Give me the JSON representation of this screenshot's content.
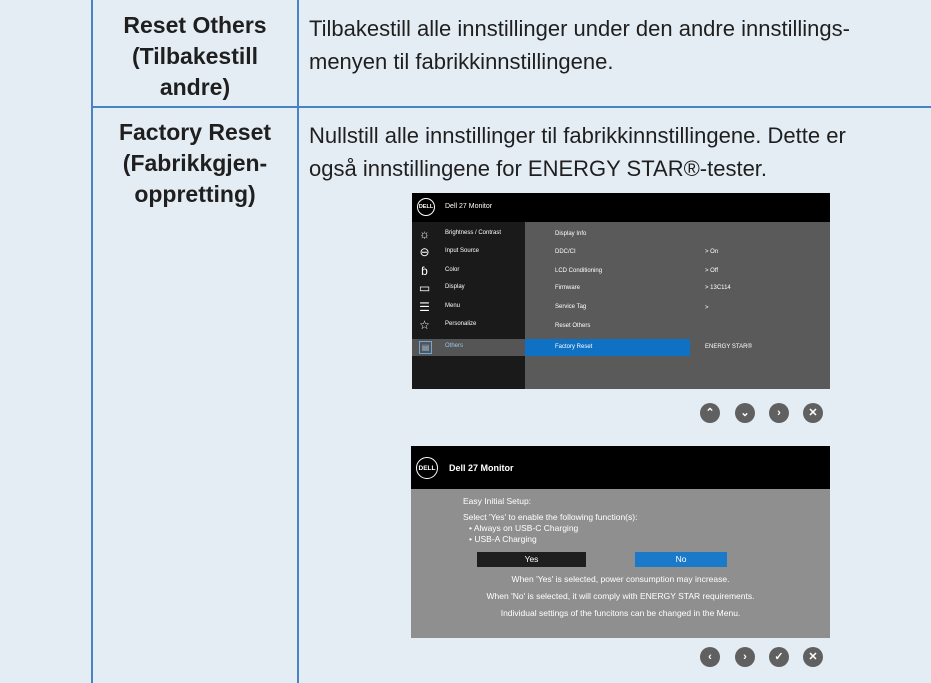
{
  "table": {
    "row1": {
      "label_lines": [
        "Reset Others",
        "(Tilbakestill",
        "andre)"
      ],
      "desc_lines": [
        "Tilbakestill alle innstillinger under den andre innstillings-",
        "menyen til fabrikkinnstillingene."
      ]
    },
    "row2": {
      "label_lines": [
        "Factory Reset",
        "(Fabrikkgjen-",
        "oppretting)"
      ],
      "desc_lines": [
        "Nullstill alle innstillinger til fabrikkinnstillingene. Dette er",
        "også innstillingene for ENERGY STAR®-tester."
      ]
    }
  },
  "osd": {
    "logo": "DELL",
    "title": "Dell 27 Monitor",
    "menu": [
      {
        "label": "Brightness / Contrast",
        "icon": "brightness-icon",
        "glyph": "☼"
      },
      {
        "label": "Input Source",
        "icon": "input-source-icon",
        "glyph": "⊖"
      },
      {
        "label": "Color",
        "icon": "color-icon",
        "glyph": "ɓ"
      },
      {
        "label": "Display",
        "icon": "display-icon",
        "glyph": "▭"
      },
      {
        "label": "Menu",
        "icon": "menu-icon",
        "glyph": "☰"
      },
      {
        "label": "Personalize",
        "icon": "star-icon",
        "glyph": "☆"
      },
      {
        "label": "Others",
        "icon": "others-icon",
        "glyph": "▤"
      }
    ],
    "items": [
      {
        "label": "Display Info",
        "value": ""
      },
      {
        "label": "DDC/CI",
        "value": ">  On"
      },
      {
        "label": "LCD Conditioning",
        "value": ">  Off"
      },
      {
        "label": "Firmware",
        "value": ">  13C114"
      },
      {
        "label": "Service Tag",
        "value": ">"
      },
      {
        "label": "Reset Others",
        "value": ""
      },
      {
        "label": "Factory Reset",
        "value": "ENERGY STAR®"
      }
    ]
  },
  "nav1": [
    {
      "icon": "chevron-up-icon",
      "glyph": "⌃"
    },
    {
      "icon": "chevron-down-icon",
      "glyph": "⌄"
    },
    {
      "icon": "chevron-right-icon",
      "glyph": "›"
    },
    {
      "icon": "close-icon",
      "glyph": "✕"
    }
  ],
  "dialog": {
    "logo": "DELL",
    "title": "Dell 27 Monitor",
    "heading": "Easy Initial Setup:",
    "prompt": "Select 'Yes' to enable the following function(s):",
    "bullets": [
      "•  Always on USB-C Charging",
      "•  USB-A Charging"
    ],
    "yes": "Yes",
    "no": "No",
    "notes": [
      "When 'Yes' is selected, power consumption may increase.",
      "When 'No' is selected, it will comply with ENERGY STAR requirements.",
      "Individual settings of the funcitons can be changed in the Menu."
    ]
  },
  "nav2": [
    {
      "icon": "chevron-left-icon",
      "glyph": "‹"
    },
    {
      "icon": "chevron-right-icon",
      "glyph": "›"
    },
    {
      "icon": "check-icon",
      "glyph": "✓"
    },
    {
      "icon": "close-icon",
      "glyph": "✕"
    }
  ],
  "colors": {
    "rule": "#4a82c8",
    "background": "#e5edf4",
    "highlight": "#0e71c4"
  }
}
